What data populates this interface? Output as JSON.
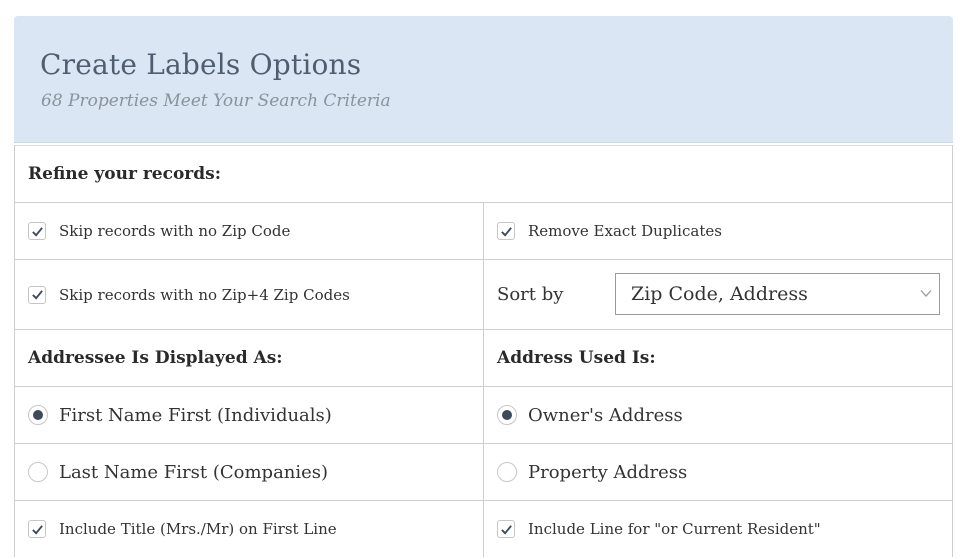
{
  "header": {
    "title": "Create Labels Options",
    "subtitle": "68 Properties Meet Your Search Criteria"
  },
  "refine": {
    "heading": "Refine your records:",
    "skip_no_zip": {
      "label": "Skip records with no Zip Code",
      "checked": true
    },
    "remove_duplicates": {
      "label": "Remove Exact Duplicates",
      "checked": true
    },
    "skip_no_zip4": {
      "label": "Skip records with no Zip+4 Zip Codes",
      "checked": true
    },
    "sort_by": {
      "label": "Sort by",
      "value": "Zip Code, Address"
    }
  },
  "addressee": {
    "heading": "Addressee Is Displayed As:",
    "options": [
      {
        "label": "First Name First (Individuals)",
        "selected": true
      },
      {
        "label": "Last Name First (Companies)",
        "selected": false
      }
    ],
    "include_title": {
      "label": "Include Title (Mrs./Mr) on First Line",
      "checked": true
    }
  },
  "address_used": {
    "heading": "Address Used Is:",
    "options": [
      {
        "label": "Owner's Address",
        "selected": true
      },
      {
        "label": "Property Address",
        "selected": false
      }
    ],
    "include_resident": {
      "label": "Include Line for \"or Current Resident\"",
      "checked": true
    }
  },
  "colors": {
    "header_bg": "#dae6f3",
    "title": "#4e5d6f",
    "radio_dot": "#3e4a5a"
  }
}
